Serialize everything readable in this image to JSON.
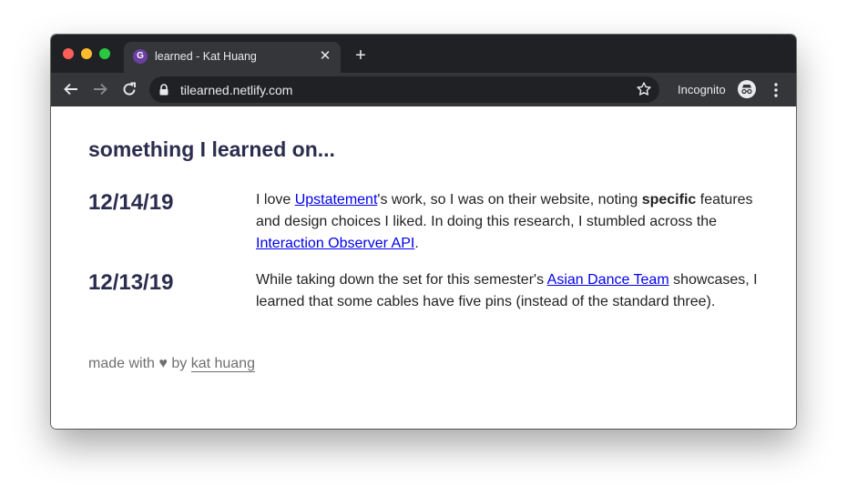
{
  "browser": {
    "tab": {
      "favicon_letter": "G",
      "title": "learned - Kat Huang",
      "close_glyph": "✕"
    },
    "new_tab_glyph": "+",
    "url": "tilearned.netlify.com",
    "incognito_label": "Incognito",
    "colors": {
      "tabstrip": "#202124",
      "toolbar": "#35363a",
      "omnibox": "#202124",
      "tab_favicon": "#6b3fa0"
    },
    "icons": [
      "back-arrow-icon",
      "forward-arrow-icon",
      "reload-icon",
      "lock-icon",
      "star-icon",
      "incognito-icon",
      "kebab-menu-icon"
    ]
  },
  "page": {
    "heading": "something I learned on...",
    "entries": [
      {
        "date": "12/14/19",
        "text_1": "I love ",
        "link_1": "Upstatement",
        "text_2": "'s work, so I was on their website, noting ",
        "bold": "specific",
        "text_3": " features and design choices I liked. In doing this research, I stumbled across the ",
        "link_2": "Interaction Observer API",
        "text_4": "."
      },
      {
        "date": "12/13/19",
        "text_1": "While taking down the set for this semester's ",
        "link_1": "Asian Dance Team",
        "text_2": " showcases, I learned that some cables have five pins (instead of the standard three)."
      }
    ],
    "footer": {
      "prefix": "made with",
      "heart": "♥",
      "by": "by",
      "author_link": "kat huang"
    },
    "colors": {
      "heading": "#2b2d4e",
      "body_text": "#222222",
      "link": "#0000ee",
      "footer": "#6f6f6f"
    }
  }
}
